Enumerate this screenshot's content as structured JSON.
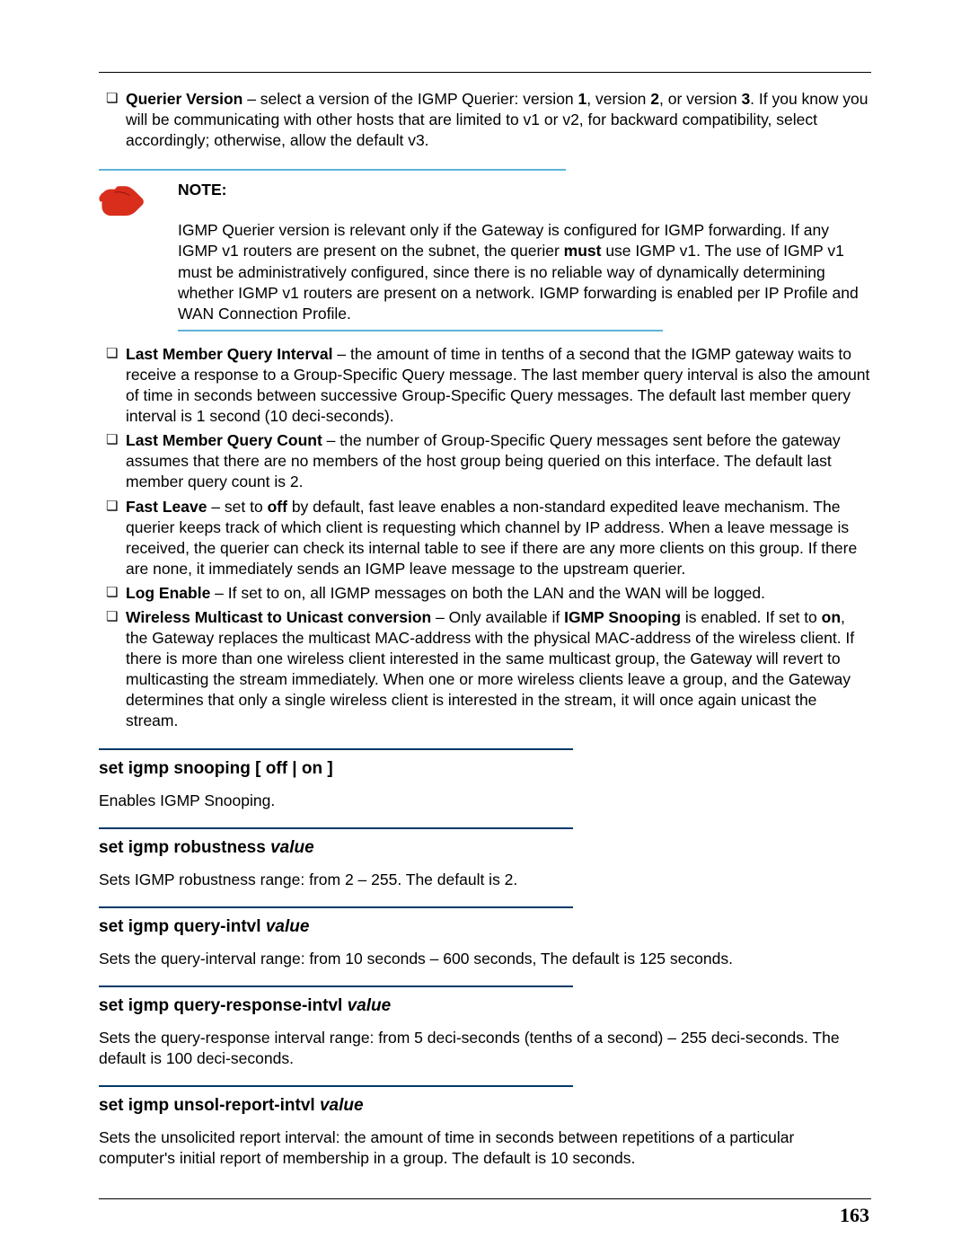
{
  "page_number": "163",
  "bullets_top": {
    "querier_version_title": "Querier Version",
    "querier_version_text_a": " – select a version of the IGMP Querier: version ",
    "querier_version_1": "1",
    "querier_version_mid1": ", version ",
    "querier_version_2": "2",
    "querier_version_mid2": ", or version ",
    "querier_version_3": "3",
    "querier_version_text_b": ". If you know you will be communicating with other hosts that are limited to v1 or v2, for backward compatibility, select accordingly; otherwise, allow the default v3."
  },
  "note": {
    "heading": "NOTE:",
    "text_a": "IGMP Querier version is relevant only if the Gateway is configured for IGMP forwarding. If any IGMP v1 routers are present on the subnet, the querier ",
    "must": "must",
    "text_b": " use IGMP v1. The use of IGMP v1 must be administratively configured, since there is no reliable way of dynamically determining whether IGMP v1 routers are present on a network. IGMP forwarding is enabled per IP Profile and WAN Connection Profile."
  },
  "bullets_mid": {
    "lmqi_title": "Last Member Query Interval",
    "lmqi_text": " – the amount of time in tenths of a second that the IGMP gateway waits to receive a response to a Group-Specific Query message. The last member query interval is also the amount of time in seconds between successive Group-Specific Query messages. The default last member query interval is 1 second (10 deci-seconds).",
    "lmqc_title": "Last Member Query Count",
    "lmqc_text": " – the number of Group-Specific Query messages sent before the gateway assumes that there are no members of the host group being queried on this interface. The default last member query count is 2.",
    "fast_leave_title": "Fast Leave",
    "fast_leave_a": " – set to ",
    "fast_leave_off": "off",
    "fast_leave_b": " by default, fast leave enables a non-standard expedited leave mechanism. The querier keeps track of which client is requesting which channel by IP address. When a leave message is received, the querier can check its internal table to see if there are any more clients on this group. If there are none, it immediately sends an IGMP leave message to the upstream querier.",
    "log_enable_title": "Log Enable",
    "log_enable_text": " – If set to on, all IGMP messages on both the LAN and the WAN will be logged.",
    "wm2u_title": "Wireless Multicast to Unicast conversion",
    "wm2u_a": " – Only available if ",
    "wm2u_snoop": "IGMP Snooping",
    "wm2u_b": " is enabled. If set to ",
    "wm2u_on": "on",
    "wm2u_c": ", the Gateway replaces the multicast MAC-address with the physical MAC-address of the wireless client. If there is more than one wireless client interested in the same multicast group, the Gateway will revert to multicasting the stream immediately. When one or more wireless clients leave a group, and the Gateway determines that only a single wireless client is interested in the stream, it will once again unicast the stream."
  },
  "sections": {
    "snooping_head": "set igmp snooping [ off | on ]",
    "snooping_desc": "Enables IGMP Snooping.",
    "robustness_head_a": "set igmp robustness ",
    "robustness_head_i": "value",
    "robustness_desc": "Sets IGMP robustness range: from 2 – 255. The default is 2.",
    "query_intvl_head_a": "set igmp query-intvl ",
    "query_intvl_head_i": "value",
    "query_intvl_desc": "Sets the query-interval range: from 10 seconds – 600 seconds, The default is 125 seconds.",
    "query_resp_head_a": "set igmp query-response-intvl ",
    "query_resp_head_i": "value",
    "query_resp_desc": "Sets the query-response interval range: from 5 deci-seconds (tenths of a second) – 255 deci-seconds. The default is 100 deci-seconds.",
    "unsol_head_a": "set igmp unsol-report-intvl ",
    "unsol_head_i": "value",
    "unsol_desc": "Sets the unsolicited report interval: the amount of time in seconds between repetitions of a particular computer's initial report of membership in a group. The default is 10 seconds."
  }
}
